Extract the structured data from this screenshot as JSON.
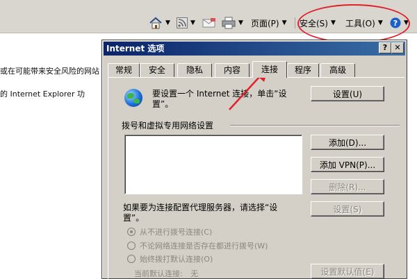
{
  "toolbar": {
    "page_label": "页面(P)",
    "safety_label": "安全(S)",
    "tools_label": "工具(O)",
    "icons": [
      "home-icon",
      "feeds-icon",
      "read-mail-icon",
      "print-icon",
      "help-icon"
    ]
  },
  "background_page": {
    "line1": "或在可能带来安全风险的网站",
    "line2": "的 Internet Explorer 功"
  },
  "dialog": {
    "title": "Internet 选项",
    "help_button": "?",
    "close_button": "✕",
    "tabs": [
      {
        "label": "常规"
      },
      {
        "label": "安全"
      },
      {
        "label": "隐私"
      },
      {
        "label": "内容"
      },
      {
        "label": "连接",
        "active": true
      },
      {
        "label": "程序"
      },
      {
        "label": "高级"
      }
    ],
    "setup_text": "要设置一个 Internet 连接，单击“设置”。",
    "setup_button": "设置(U)",
    "dialup_section": "拨号和虚拟专用网络设置",
    "add_button": "添加(D)...",
    "add_vpn_button": "添加 VPN(P)...",
    "remove_button": "删除(R)...",
    "proxy_text": "如果要为连接配置代理服务器，请选择“设置”。",
    "settings_button": "设置(S)",
    "radio_options": [
      {
        "label": "从不进行拨号连接(C)",
        "checked": true
      },
      {
        "label": "不论网络连接是否存在都进行拨号(W)",
        "checked": false
      },
      {
        "label": "始终拨打默认连接(O)",
        "checked": false
      }
    ],
    "default_conn_label": "当前默认连接:",
    "default_conn_value": "无",
    "set_default_button": "设置默认值(E)"
  },
  "colors": {
    "annotation": "#e0202b",
    "title_gradient_start": "#0a246a",
    "dialog_face": "#d4d0c8"
  }
}
